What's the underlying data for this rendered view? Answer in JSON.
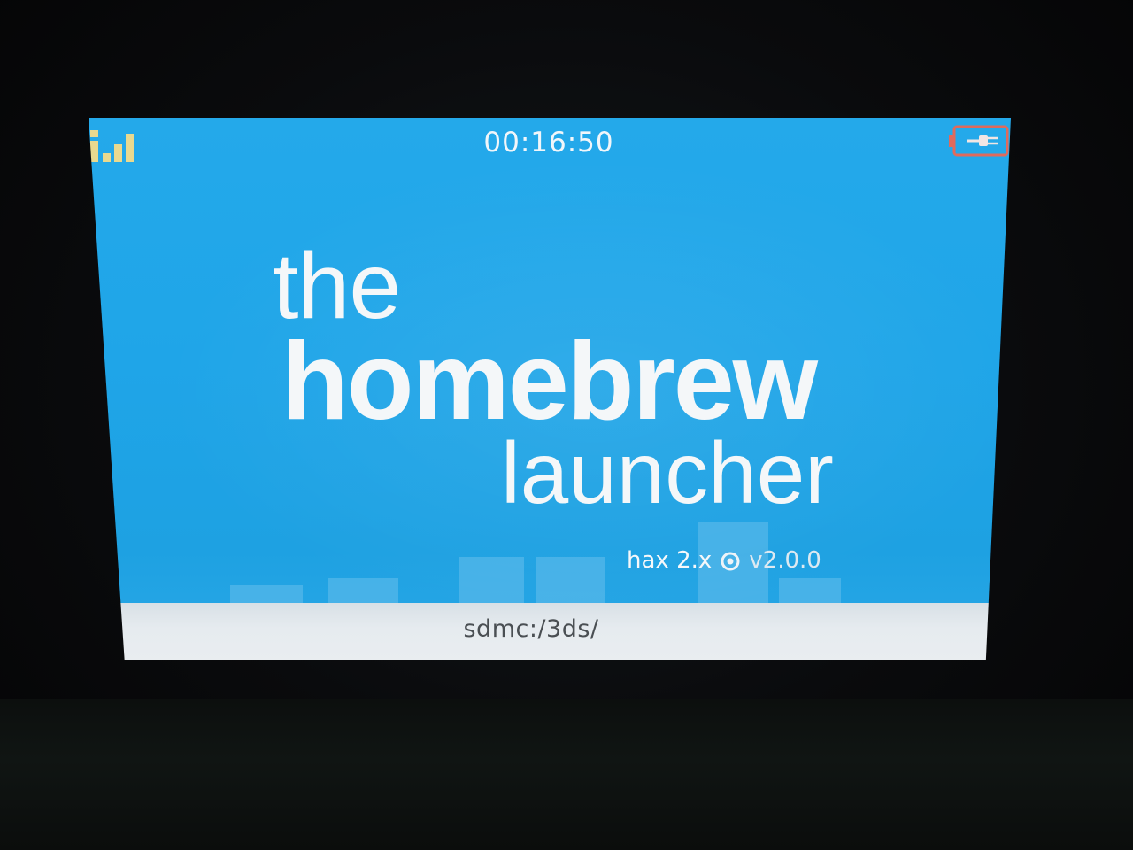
{
  "status_bar": {
    "clock": "00:16:50",
    "signal_icon": "signal-strength-icon",
    "battery_icon": "battery-charging-icon"
  },
  "logo": {
    "line1": "the",
    "line2": "homebrew",
    "line3": "launcher"
  },
  "version": {
    "hax": "hax 2.x",
    "separator_icon": "target-icon",
    "launcher_version": "v2.0.0"
  },
  "path_bar": {
    "path": "sdmc:/3ds/"
  },
  "colors": {
    "screen_background": "#1fa5e8",
    "logo_text": "#f4f7f9",
    "path_bar_background": "#e6ebef",
    "path_text": "#4a4f53",
    "battery_outline": "#e06a5c"
  }
}
